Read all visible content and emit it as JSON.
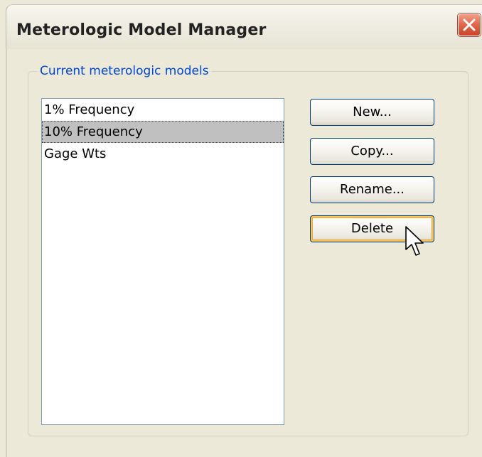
{
  "window": {
    "title": "Meterologic Model Manager",
    "close_icon": "close-icon",
    "accent_close": "#e46a4e"
  },
  "group": {
    "label": "Current meterologic models"
  },
  "models": {
    "items": [
      {
        "label": "1% Frequency",
        "selected": false
      },
      {
        "label": "10% Frequency",
        "selected": true
      },
      {
        "label": "Gage Wts",
        "selected": false
      }
    ]
  },
  "buttons": {
    "new_label": "New...",
    "copy_label": "Copy...",
    "rename_label": "Rename...",
    "delete_label": "Delete"
  },
  "cursor": {
    "icon": "mouse-pointer-icon"
  }
}
